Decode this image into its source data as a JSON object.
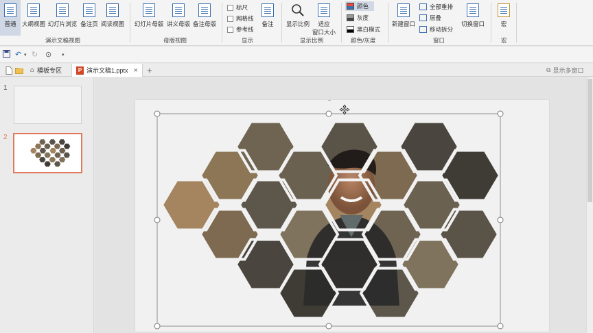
{
  "ribbon": {
    "view_buttons": {
      "normal": "普通",
      "outline": "大纲视图",
      "sorter": "幻灯片浏览",
      "notes_page": "备注页",
      "reading": "阅读视图"
    },
    "group_presentation_views": "演示文稿视图",
    "master_buttons": {
      "slide_master": "幻灯片母版",
      "handout_master": "讲义母版",
      "notes_master": "备注母版"
    },
    "group_master_views": "母版视图",
    "show": {
      "ruler": "标尺",
      "gridlines": "网格线",
      "guides": "参考线",
      "notes": "备注"
    },
    "group_show": "显示",
    "zoom": {
      "zoom": "显示比例",
      "fit_line1": "适应",
      "fit_line2": "窗口大小"
    },
    "group_zoom": "显示比例",
    "color": {
      "color": "颜色",
      "grayscale": "灰度",
      "bw": "黑白模式"
    },
    "group_color": "颜色/灰度",
    "window": {
      "new_window": "新建窗口",
      "arrange_all": "全部重排",
      "cascade": "层叠",
      "move_split": "移动拆分",
      "switch_windows": "切换窗口"
    },
    "group_window": "窗口",
    "macros": {
      "macros": "宏"
    },
    "group_macros": "宏"
  },
  "qat": {
    "save_icon": "save-icon",
    "undo_icon": "undo-icon",
    "redo_icon": "redo-icon"
  },
  "tabs": {
    "templates": "模板专区",
    "document": "演示文稿1.pptx",
    "add": "+",
    "multi_window": "显示多窗口",
    "close": "×"
  },
  "thumbnails": [
    {
      "number": "1"
    },
    {
      "number": "2"
    }
  ],
  "colors": {
    "accent_thumb_border": "#e07a5f",
    "ppt_icon": "#d24625",
    "ribbon_bg": "#f4f4f4"
  }
}
